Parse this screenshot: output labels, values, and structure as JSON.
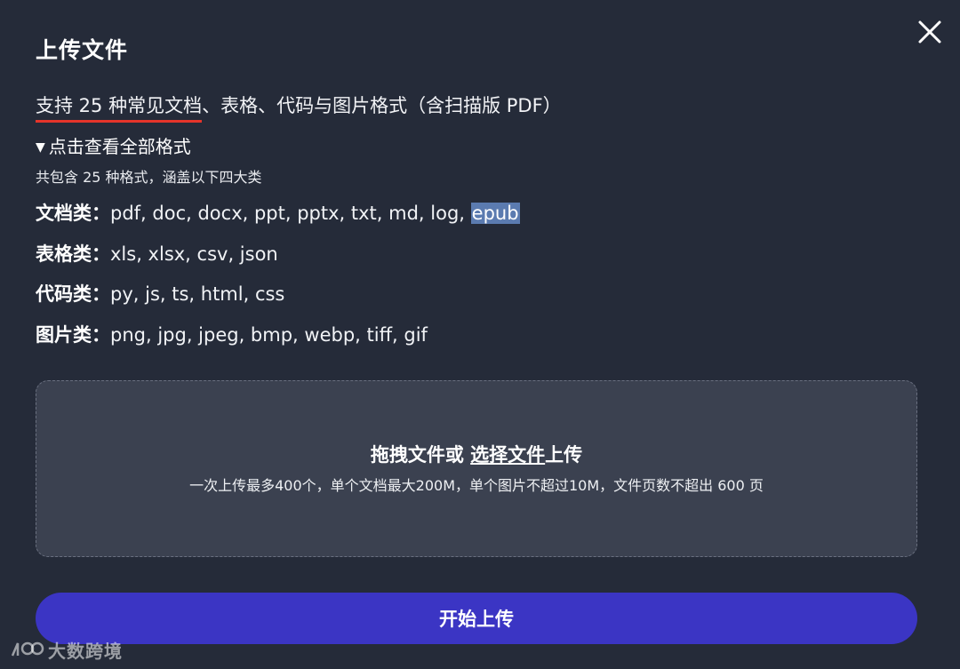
{
  "dialog": {
    "title": "上传文件"
  },
  "support": {
    "highlight": "支持 25 种常见文档",
    "rest": "、表格、代码与图片格式（含扫描版 PDF）"
  },
  "toggle": {
    "arrow": "▼",
    "label": "点击查看全部格式"
  },
  "summary": "共包含 25 种格式，涵盖以下四大类",
  "formats": [
    {
      "category": "文档类：",
      "list": "pdf, doc, docx, ppt, pptx, txt, md, log, ",
      "selected": "epub"
    },
    {
      "category": "表格类：",
      "list": "xls, xlsx, csv, json"
    },
    {
      "category": "代码类：",
      "list": "py, js, ts, html, css"
    },
    {
      "category": "图片类：",
      "list": "png, jpg, jpeg, bmp, webp, tiff, gif"
    }
  ],
  "dropzone": {
    "prefix": "拖拽文件或 ",
    "link": "选择文件",
    "suffix": "上传",
    "limits": "一次上传最多400个，单个文档最大200M，单个图片不超过10M，文件页数不超出 600 页"
  },
  "upload_button": "开始上传",
  "watermark": "大数跨境",
  "icons": {
    "close": "close-icon",
    "toggle": "triangle-down-icon",
    "logo": "watermark-logo-icon"
  },
  "colors": {
    "background": "#252b39",
    "dropzone": "#3b4150",
    "primary": "#3b35c4",
    "underline": "#e5342a",
    "selection": "#5b7bb0"
  }
}
